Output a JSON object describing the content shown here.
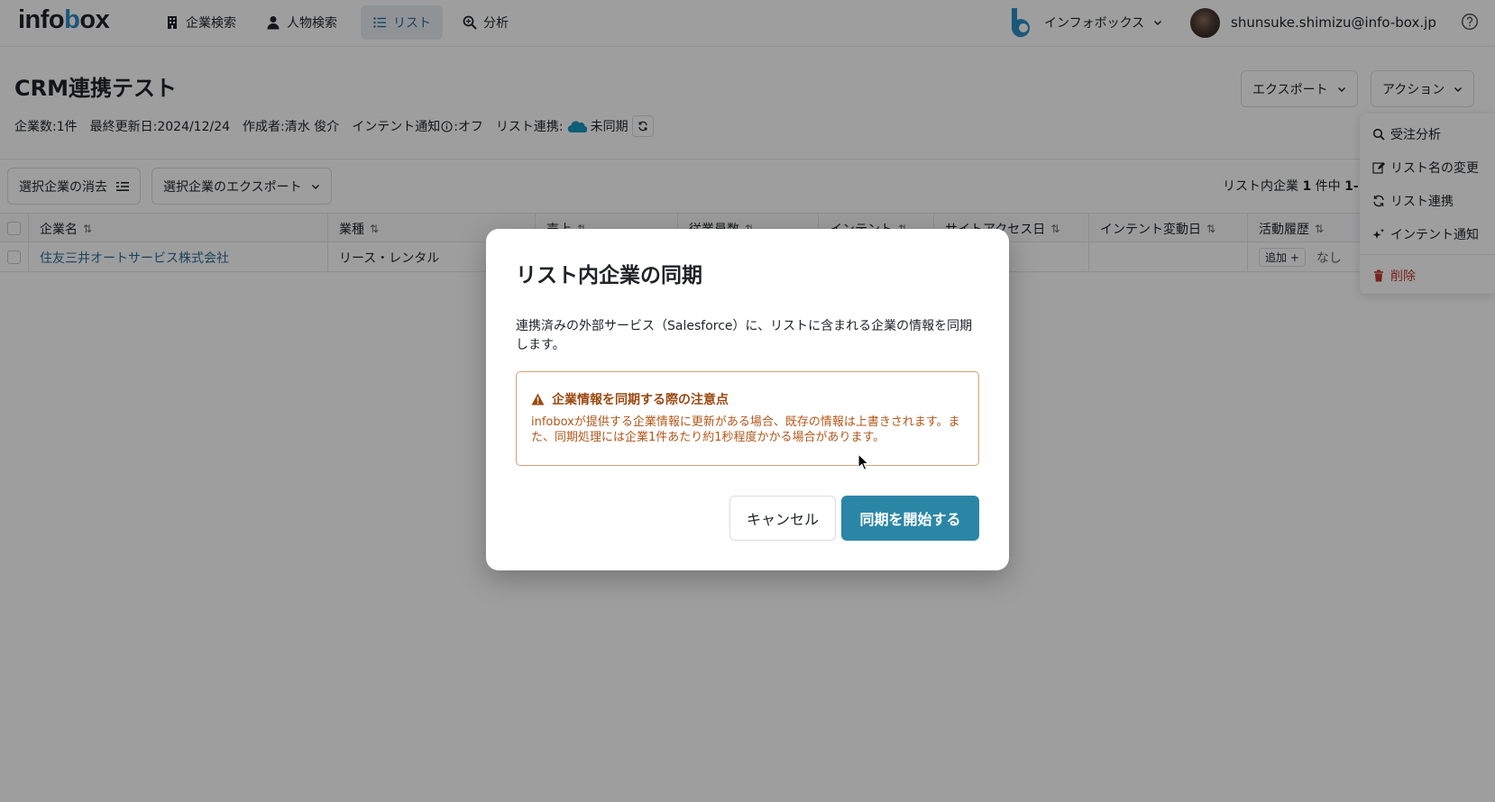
{
  "nav": {
    "logo": {
      "pre": "info",
      "accent": "b",
      "post": "ox"
    },
    "items": [
      {
        "label": "企業検索",
        "icon": "building-icon"
      },
      {
        "label": "人物検索",
        "icon": "person-icon"
      },
      {
        "label": "リスト",
        "icon": "list-icon",
        "active": true
      },
      {
        "label": "分析",
        "icon": "analysis-icon"
      }
    ],
    "org_name": "インフォボックス",
    "user_email": "shunsuke.shimizu@info-box.jp"
  },
  "page": {
    "title": "CRM連携テスト",
    "meta": {
      "company_count": "企業数:1件",
      "last_updated": "最終更新日:2024/12/24",
      "creator": "作成者:清水 俊介",
      "intent_notify": "インテント通知",
      "intent_notify_value": ":オフ",
      "list_link_label": "リスト連携:",
      "sync_status": "未同期"
    },
    "export_button": "エクスポート",
    "action_button": "アクション"
  },
  "action_menu": {
    "items": [
      {
        "label": "受注分析",
        "icon": "search-analysis-icon"
      },
      {
        "label": "リスト名の変更",
        "icon": "edit-icon"
      },
      {
        "label": "リスト連携",
        "icon": "sync-icon"
      },
      {
        "label": "インテント通知",
        "icon": "sparkle-icon"
      }
    ],
    "delete_label": "削除"
  },
  "toolbar": {
    "clear_selection": "選択企業の消去",
    "export_selected": "選択企業のエクスポート",
    "count_prefix": "リスト内企業",
    "count_bold": "1",
    "count_mid": "件中",
    "count_range": "1-"
  },
  "table": {
    "headers": [
      "企業名",
      "業種",
      "売上",
      "従業員数",
      "インテント",
      "サイトアクセス日",
      "インテント変動日",
      "活動履歴"
    ],
    "rows": [
      {
        "company": "住友三井オートサービス株式会社",
        "industry": "リース・レンタル",
        "activity_add": "追加 +",
        "activity_none": "なし"
      }
    ]
  },
  "modal": {
    "title": "リスト内企業の同期",
    "description": "連携済みの外部サービス（Salesforce）に、リストに含まれる企業の情報を同期します。",
    "warning_title": "企業情報を同期する際の注意点",
    "warning_body": "infoboxが提供する企業情報に更新がある場合、既存の情報は上書きされます。また、同期処理には企業1件あたり約1秒程度かかる場合があります。",
    "cancel_label": "キャンセル",
    "confirm_label": "同期を開始する"
  },
  "colors": {
    "primary": "#2b86a6",
    "link": "#2e6d9a",
    "warning_text": "#b2571a",
    "warning_border": "#d7a17a",
    "danger": "#c0392b",
    "brand_blue": "#2c8dc4"
  }
}
